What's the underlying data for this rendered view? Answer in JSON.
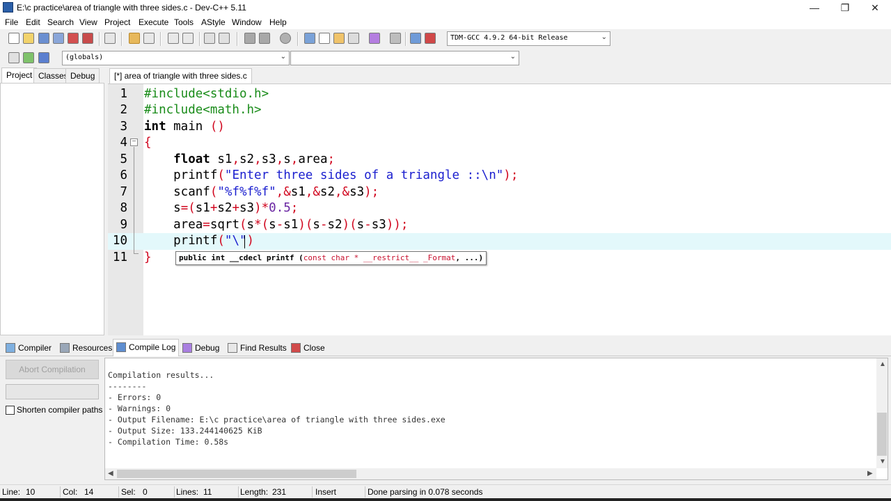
{
  "window": {
    "title": "E:\\c practice\\area of triangle with three sides.c - Dev-C++ 5.11",
    "minimize": "—",
    "restore": "❐",
    "close": "✕"
  },
  "menu": [
    "File",
    "Edit",
    "Search",
    "View",
    "Project",
    "Execute",
    "Tools",
    "AStyle",
    "Window",
    "Help"
  ],
  "toolbar": {
    "compiler_select": "TDM-GCC 4.9.2 64-bit Release",
    "scope_select": "(globals)",
    "member_select": ""
  },
  "left_tabs": [
    "Project",
    "Classes",
    "Debug"
  ],
  "editor": {
    "tab_label": "[*] area of triangle with three sides.c",
    "current_line": 10,
    "hint": {
      "part1": "public int __cdecl printf (",
      "part2": "const char * __restrict__ _Format",
      "part3": ", ...)"
    },
    "lines": [
      {
        "n": "1",
        "segments": [
          [
            "pre",
            "#include<stdio.h>"
          ]
        ]
      },
      {
        "n": "2",
        "segments": [
          [
            "pre",
            "#include<math.h>"
          ]
        ]
      },
      {
        "n": "3",
        "segments": [
          [
            "kw",
            "int"
          ],
          [
            "plain",
            " main "
          ],
          [
            "sym",
            "()"
          ]
        ]
      },
      {
        "n": "4",
        "segments": [
          [
            "sym",
            "{"
          ]
        ]
      },
      {
        "n": "5",
        "segments": [
          [
            "plain",
            "    "
          ],
          [
            "kw",
            "float"
          ],
          [
            "plain",
            " s1"
          ],
          [
            "sym",
            ","
          ],
          [
            "plain",
            "s2"
          ],
          [
            "sym",
            ","
          ],
          [
            "plain",
            "s3"
          ],
          [
            "sym",
            ","
          ],
          [
            "plain",
            "s"
          ],
          [
            "sym",
            ","
          ],
          [
            "plain",
            "area"
          ],
          [
            "sym",
            ";"
          ]
        ]
      },
      {
        "n": "6",
        "segments": [
          [
            "plain",
            "    printf"
          ],
          [
            "sym",
            "("
          ],
          [
            "str",
            "\"Enter three sides of a triangle ::\\n\""
          ],
          [
            "sym",
            ");"
          ]
        ]
      },
      {
        "n": "7",
        "segments": [
          [
            "plain",
            "    scanf"
          ],
          [
            "sym",
            "("
          ],
          [
            "str",
            "\"%f%f%f\""
          ],
          [
            "sym",
            ",&"
          ],
          [
            "plain",
            "s1"
          ],
          [
            "sym",
            ",&"
          ],
          [
            "plain",
            "s2"
          ],
          [
            "sym",
            ",&"
          ],
          [
            "plain",
            "s3"
          ],
          [
            "sym",
            ");"
          ]
        ]
      },
      {
        "n": "8",
        "segments": [
          [
            "plain",
            "    s"
          ],
          [
            "sym",
            "=("
          ],
          [
            "plain",
            "s1"
          ],
          [
            "sym",
            "+"
          ],
          [
            "plain",
            "s2"
          ],
          [
            "sym",
            "+"
          ],
          [
            "plain",
            "s3"
          ],
          [
            "sym",
            ")*"
          ],
          [
            "num",
            "0.5"
          ],
          [
            "sym",
            ";"
          ]
        ]
      },
      {
        "n": "9",
        "segments": [
          [
            "plain",
            "    area"
          ],
          [
            "sym",
            "="
          ],
          [
            "plain",
            "sqrt"
          ],
          [
            "sym",
            "("
          ],
          [
            "plain",
            "s"
          ],
          [
            "sym",
            "*("
          ],
          [
            "plain",
            "s"
          ],
          [
            "sym",
            "-"
          ],
          [
            "plain",
            "s1"
          ],
          [
            "sym",
            ")("
          ],
          [
            "plain",
            "s"
          ],
          [
            "sym",
            "-"
          ],
          [
            "plain",
            "s2"
          ],
          [
            "sym",
            ")("
          ],
          [
            "plain",
            "s"
          ],
          [
            "sym",
            "-"
          ],
          [
            "plain",
            "s3"
          ],
          [
            "sym",
            "));"
          ]
        ]
      },
      {
        "n": "10",
        "segments": [
          [
            "plain",
            "    printf"
          ],
          [
            "sym",
            "("
          ],
          [
            "str",
            "\"\\\""
          ],
          [
            "sym",
            ")"
          ]
        ]
      },
      {
        "n": "11",
        "segments": [
          [
            "sym",
            "}"
          ]
        ]
      }
    ]
  },
  "bottom_tabs": [
    "Compiler",
    "Resources",
    "Compile Log",
    "Debug",
    "Find Results",
    "Close"
  ],
  "compile_panel": {
    "abort_label": "Abort Compilation",
    "shorten_label": "Shorten compiler paths",
    "log": [
      "Compilation results...",
      "--------",
      "- Errors: 0",
      "- Warnings: 0",
      "- Output Filename: E:\\c practice\\area of triangle with three sides.exe",
      "- Output Size: 133.244140625 KiB",
      "- Compilation Time: 0.58s"
    ]
  },
  "status": {
    "line_label": "Line:",
    "line_val": "10",
    "col_label": "Col:",
    "col_val": "14",
    "sel_label": "Sel:",
    "sel_val": "0",
    "lines_label": "Lines:",
    "lines_val": "11",
    "length_label": "Length:",
    "length_val": "231",
    "mode": "Insert",
    "message": "Done parsing in 0.078 seconds"
  }
}
